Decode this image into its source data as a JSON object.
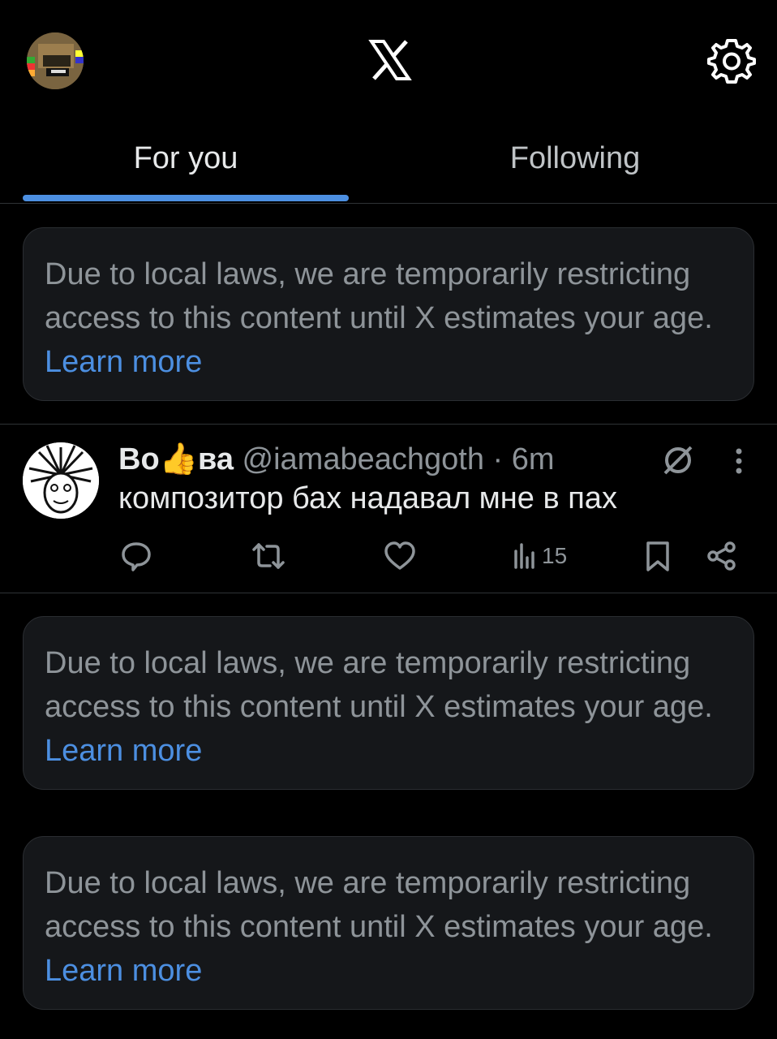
{
  "header": {
    "avatar_icon": "profile-avatar",
    "logo_icon": "x-logo-icon",
    "settings_icon": "gear-icon"
  },
  "tabs": [
    {
      "label": "For you",
      "active": true
    },
    {
      "label": "Following",
      "active": false
    }
  ],
  "notices": [
    {
      "text": "Due to local laws, we are temporarily restricting access to this content until X estimates your age.",
      "link": "Learn more"
    },
    {
      "text": "Due to local laws, we are temporarily restricting access to this content until X estimates your age.",
      "link": "Learn more"
    },
    {
      "text": "Due to local laws, we are temporarily restricting access to this content until X estimates your age.",
      "link": "Learn more"
    }
  ],
  "post": {
    "author_name": "Во👍ва",
    "handle": "@iamabeachgoth",
    "time": "· 6m",
    "text": "композитор бах надавал мне в пах",
    "views": "15",
    "icons": {
      "reply": "reply-icon",
      "repost": "repost-icon",
      "like": "heart-icon",
      "views": "views-icon",
      "bookmark": "bookmark-icon",
      "share": "share-icon",
      "grok": "slash-circle-icon",
      "more": "more-dots-icon"
    }
  },
  "colors": {
    "background": "#000000",
    "accent": "#4c8fe1",
    "muted_text": "#8e9499",
    "notice_bg": "#15171a"
  }
}
